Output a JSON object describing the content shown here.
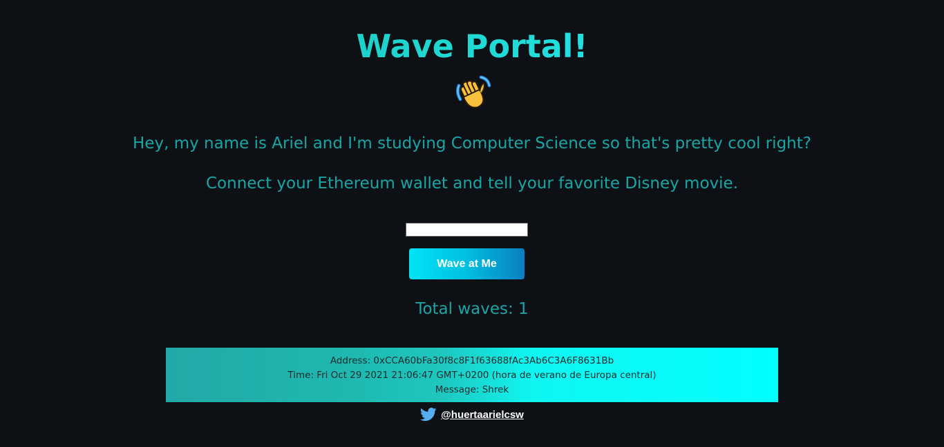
{
  "header": {
    "title": "Wave Portal!",
    "emoji_icon": "waving-hand-icon"
  },
  "bio": {
    "line1": "Hey, my name is Ariel and I'm studying Computer Science so that's pretty cool right?",
    "line2": "Connect your Ethereum wallet and tell your favorite Disney movie."
  },
  "form": {
    "input_value": "",
    "input_placeholder": "",
    "button_label": "Wave at Me"
  },
  "stats": {
    "total_waves_text": "Total waves: 1"
  },
  "waves": [
    {
      "address_text": "Address: 0xCCA60bFa30f8c8F1f63688fAc3Ab6C3A6F8631Bb",
      "time_text": "Time: Fri Oct 29 2021 21:06:47 GMT+0200 (hora de verano de Europa central)",
      "message_text": "Message: Shrek"
    }
  ],
  "footer": {
    "twitter_icon": "twitter-bird-icon",
    "twitter_handle": "@huertaarielcsw"
  },
  "colors": {
    "background": "#0d1116",
    "accent_teal": "#1aa5a5",
    "accent_cyan": "#00ffff",
    "twitter_blue": "#55acee"
  }
}
